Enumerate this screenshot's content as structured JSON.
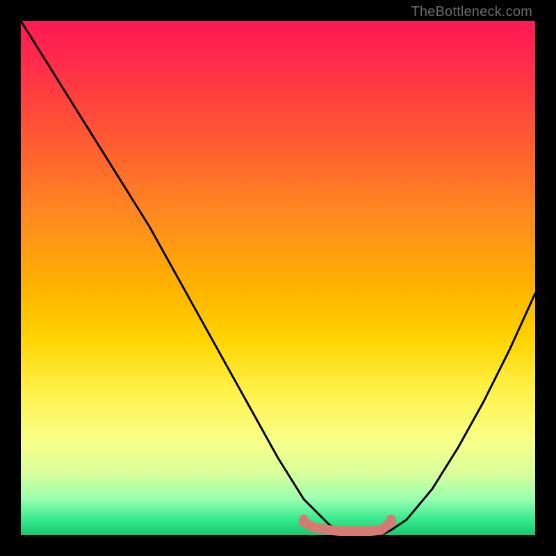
{
  "watermark": "TheBottleneck.com",
  "chart_data": {
    "type": "line",
    "title": "",
    "xlabel": "",
    "ylabel": "",
    "xlim": [
      0,
      100
    ],
    "ylim": [
      0,
      100
    ],
    "grid": false,
    "legend": false,
    "series": [
      {
        "name": "bottleneck-curve",
        "color": "#000000",
        "x": [
          0,
          5,
          10,
          15,
          20,
          25,
          30,
          35,
          40,
          45,
          50,
          55,
          60,
          62,
          64,
          66,
          68,
          70,
          72,
          75,
          80,
          85,
          90,
          95,
          100
        ],
        "y": [
          100,
          92,
          84,
          76,
          68,
          60,
          51,
          42,
          33,
          24,
          15,
          7,
          2,
          1,
          0,
          0,
          0,
          0,
          1,
          3,
          9,
          17,
          26,
          36,
          47
        ]
      },
      {
        "name": "highlight-flat",
        "color": "#d67a74",
        "x": [
          55,
          57,
          60,
          62,
          64,
          66,
          68,
          70,
          72
        ],
        "y": [
          2.5,
          1.5,
          1,
          0.8,
          0.8,
          0.8,
          0.8,
          1,
          2.5
        ]
      }
    ],
    "markers": [
      {
        "name": "dot-left",
        "x": 55,
        "y": 3,
        "color": "#d67a74"
      },
      {
        "name": "dot-right",
        "x": 72,
        "y": 3,
        "color": "#d67a74"
      }
    ],
    "background_gradient": {
      "top": "#ff1a55",
      "mid": "#ffd400",
      "bottom": "#18c86f"
    }
  }
}
